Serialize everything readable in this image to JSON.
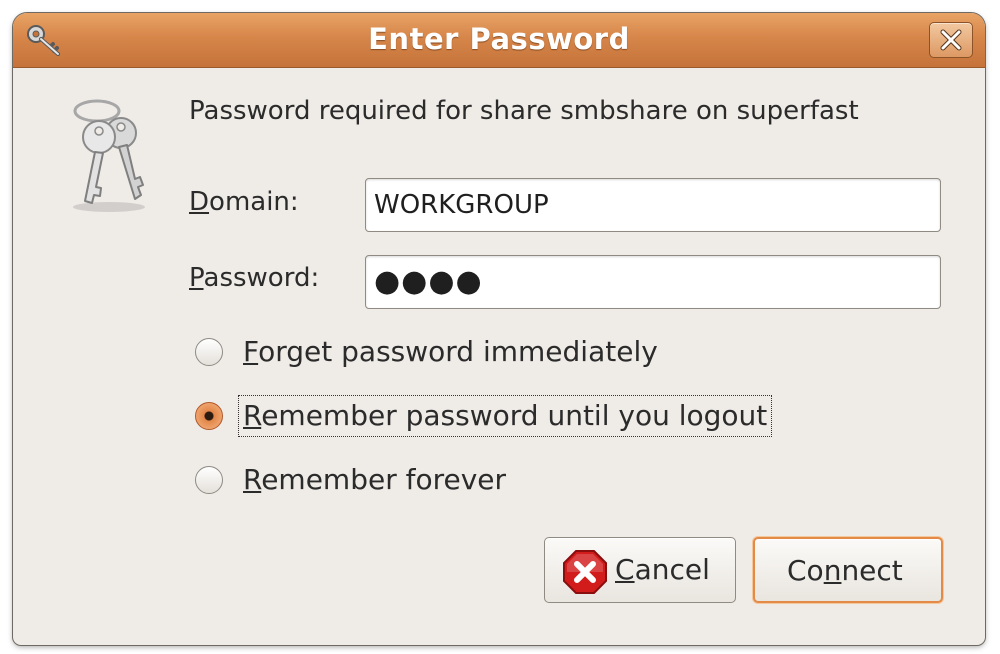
{
  "window": {
    "title": "Enter Password",
    "accent_color": "#d7864a"
  },
  "dialog": {
    "message": "Password required for share smbshare on superfast",
    "domain": {
      "label_mnemonic": "D",
      "label_rest": "omain:",
      "value": "WORKGROUP"
    },
    "password": {
      "label_mnemonic": "P",
      "label_rest": "assword:",
      "masked_value": "●●●●"
    },
    "options": [
      {
        "mnemonic": "F",
        "rest": "orget password immediately",
        "selected": false
      },
      {
        "mnemonic": "R",
        "rest": "emember password until you logout",
        "selected": true
      },
      {
        "mnemonic": "R",
        "rest": "emember forever",
        "selected": false
      }
    ],
    "buttons": {
      "cancel_mnemonic": "C",
      "cancel_rest": "ancel",
      "connect_pre": "Co",
      "connect_mnemonic": "n",
      "connect_post": "nect"
    }
  },
  "icons": {
    "title": "keys-icon",
    "close": "close-icon",
    "dialog": "keys-icon",
    "cancel": "stop-icon"
  }
}
